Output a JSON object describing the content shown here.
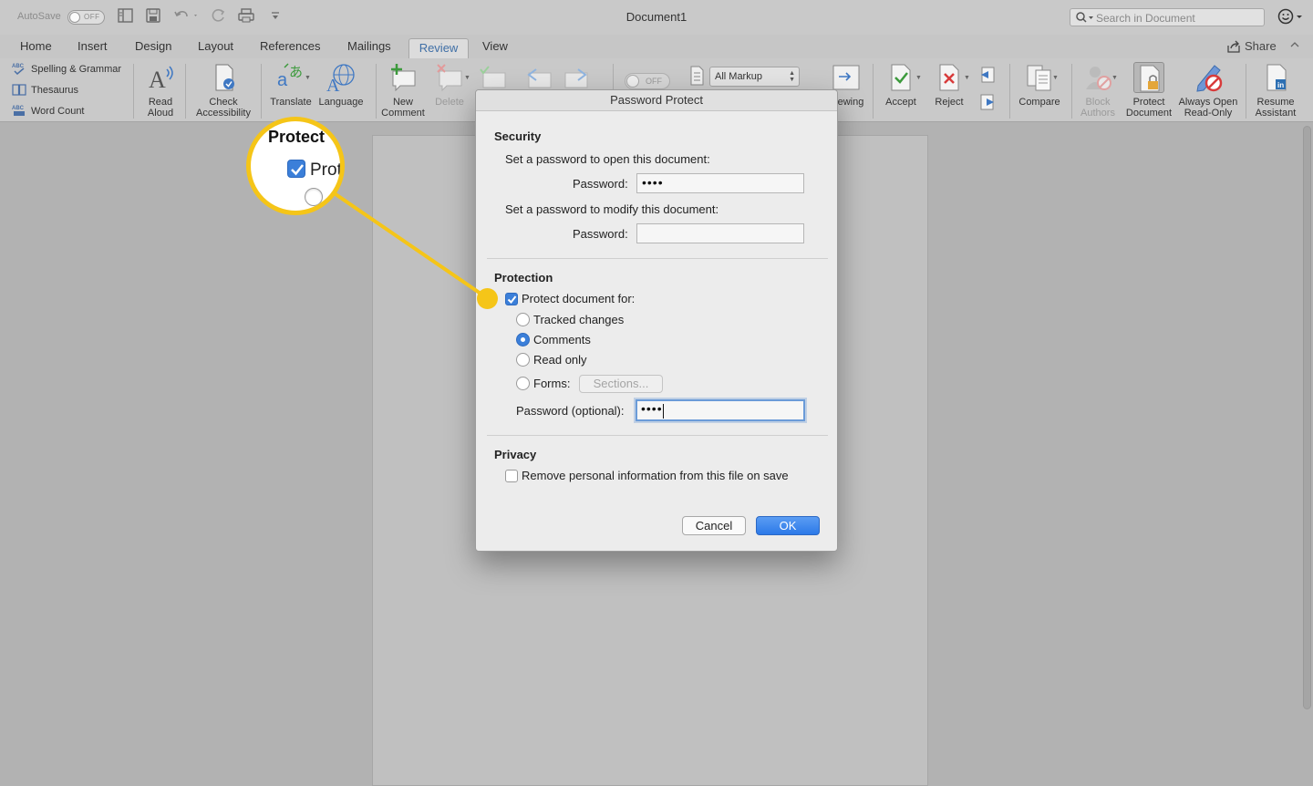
{
  "window": {
    "title": "Document1"
  },
  "titlebar": {
    "autosave_label": "AutoSave",
    "autosave_state": "OFF",
    "search_placeholder": "Search in Document"
  },
  "tabs": [
    {
      "label": "Home"
    },
    {
      "label": "Insert"
    },
    {
      "label": "Design"
    },
    {
      "label": "Layout"
    },
    {
      "label": "References"
    },
    {
      "label": "Mailings"
    },
    {
      "label": "Review"
    },
    {
      "label": "View"
    }
  ],
  "active_tab": "Review",
  "share_label": "Share",
  "ribbon": {
    "proofing": [
      "Spelling & Grammar",
      "Thesaurus",
      "Word Count"
    ],
    "read_aloud": [
      "Read",
      "Aloud"
    ],
    "check_accessibility": [
      "Check",
      "Accessibility"
    ],
    "translate": "Translate",
    "language": "Language",
    "new_comment": [
      "New",
      "Comment"
    ],
    "delete": "Delete",
    "track_toggle_state": "OFF",
    "markup_select": "All Markup",
    "reviewing_partial": "ewing",
    "accept": "Accept",
    "reject": "Reject",
    "compare": "Compare",
    "block_authors": [
      "Block",
      "Authors"
    ],
    "protect_document": [
      "Protect",
      "Document"
    ],
    "always_open_readonly": [
      "Always Open",
      "Read-Only"
    ],
    "resume_assistant": [
      "Resume",
      "Assistant"
    ]
  },
  "dialog": {
    "title": "Password Protect",
    "security": {
      "heading": "Security",
      "open_prompt": "Set a password to open this document:",
      "password_label": "Password:",
      "open_password_value": "••••",
      "modify_prompt": "Set a password to modify this document:",
      "modify_password_value": ""
    },
    "protection": {
      "heading": "Protection",
      "protect_label": "Protect document for:",
      "protect_checked": true,
      "options": [
        "Tracked changes",
        "Comments",
        "Read only",
        "Forms:"
      ],
      "selected_option": "Comments",
      "sections_button": "Sections...",
      "optional_password_label": "Password (optional):",
      "optional_password_value": "••••"
    },
    "privacy": {
      "heading": "Privacy",
      "remove_info_label": "Remove personal information from this file on save",
      "remove_info_checked": false
    },
    "buttons": {
      "cancel": "Cancel",
      "ok": "OK"
    }
  },
  "callout": {
    "zoom_title": "Protect",
    "zoom_checkbox_text": "Prot",
    "highlight_color": "#f5c518"
  }
}
